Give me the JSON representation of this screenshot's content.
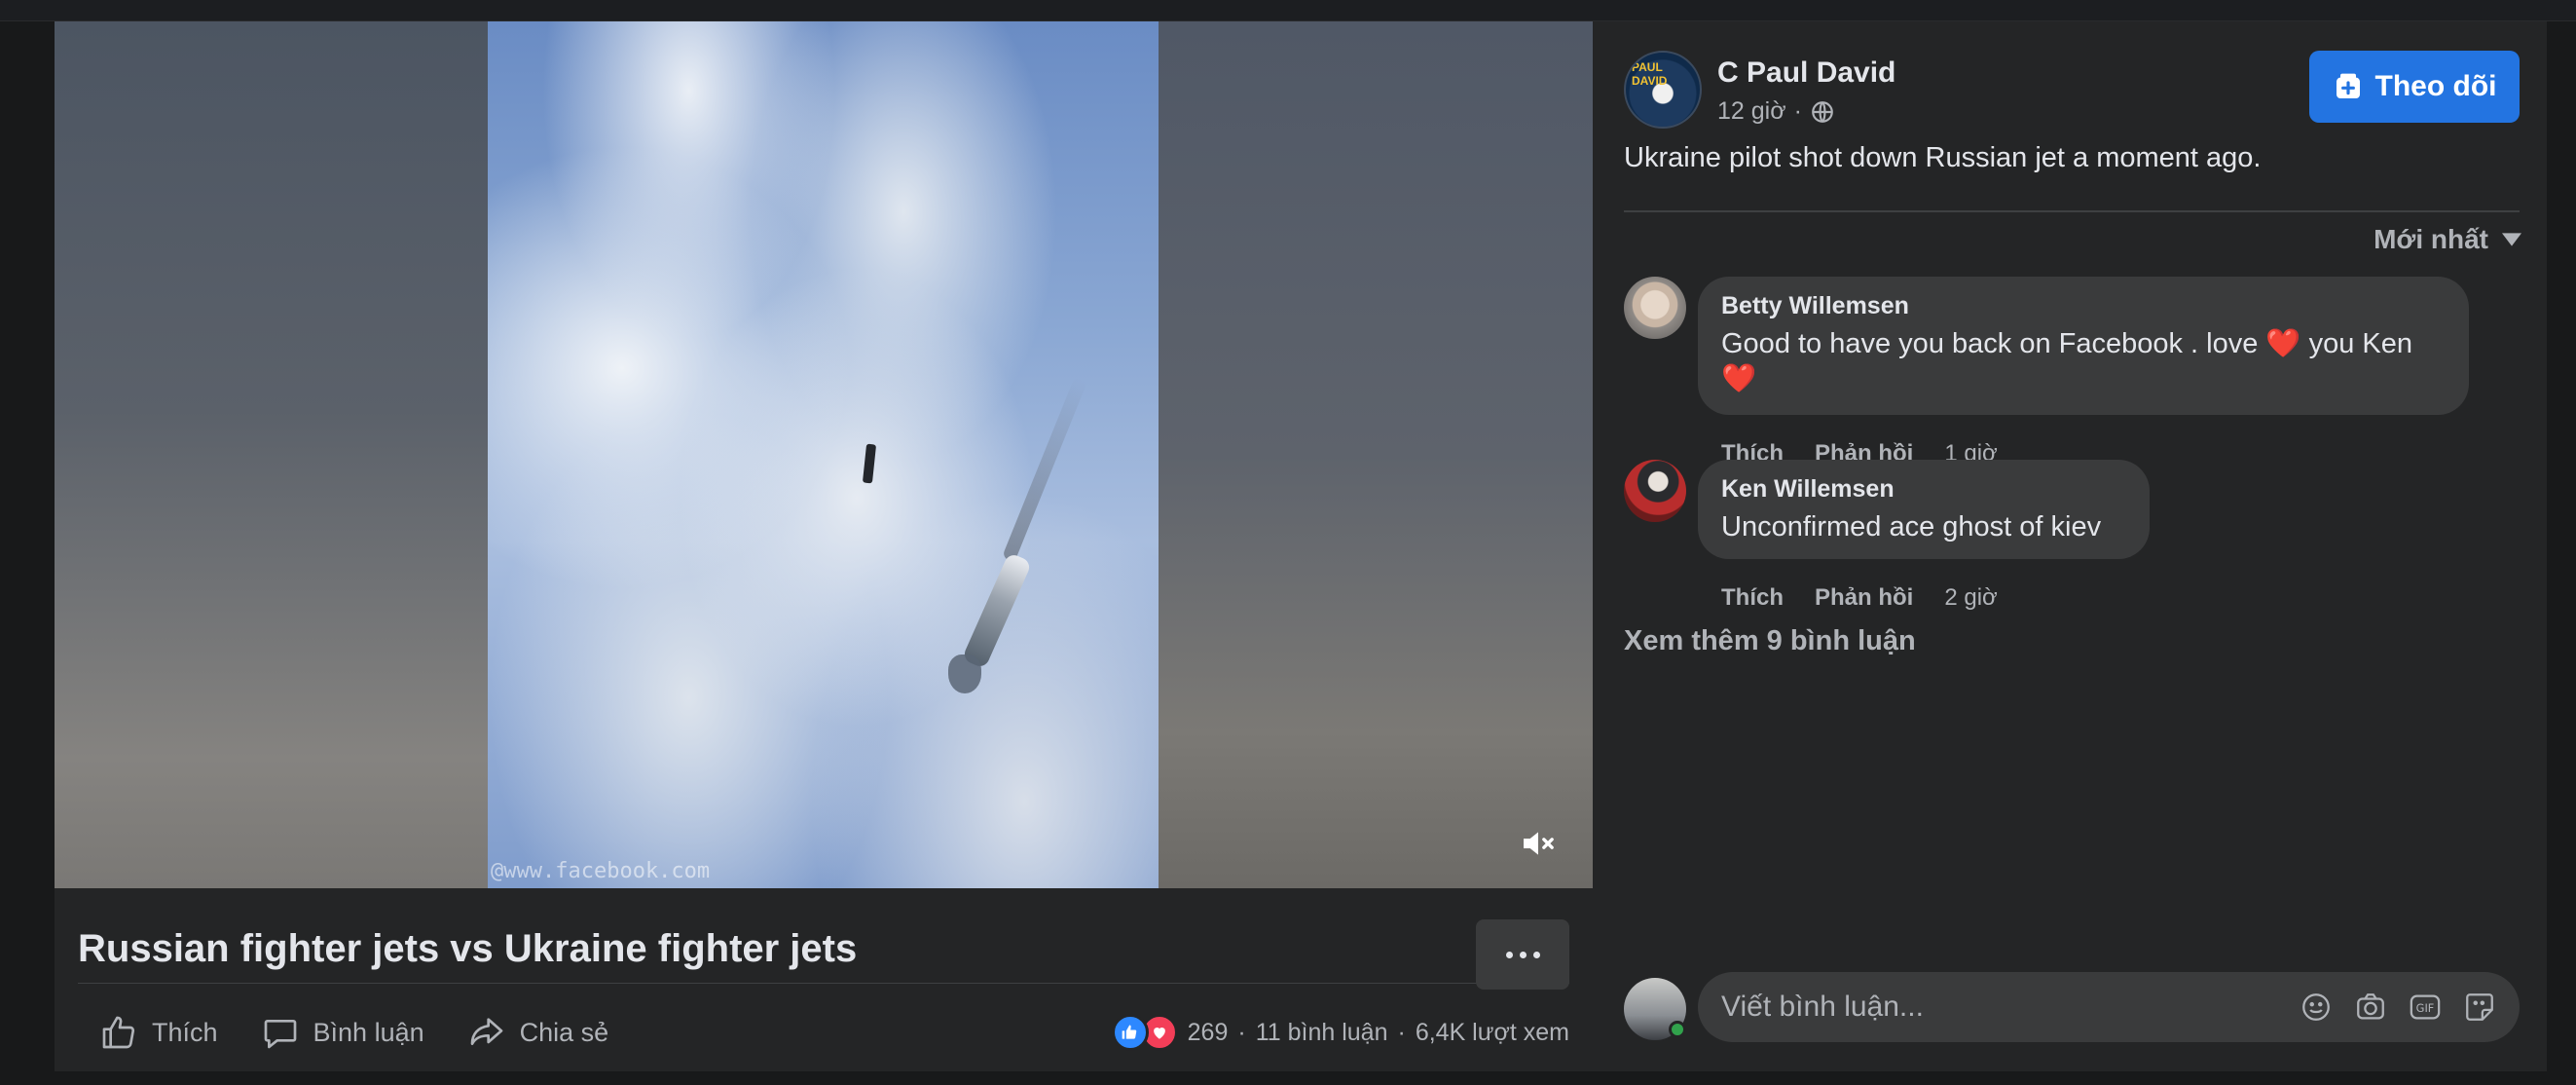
{
  "video": {
    "watermark": "@www.facebook.com",
    "title": "Russian fighter jets vs Ukraine fighter jets",
    "mute_icon": "speaker-muted-icon",
    "more_icon": "ellipsis-icon"
  },
  "actions": {
    "like_label": "Thích",
    "comment_label": "Bình luận",
    "share_label": "Chia sẻ"
  },
  "stats": {
    "reaction_count": "269",
    "sep1": "·",
    "comments": "11 bình luận",
    "sep2": "·",
    "views": "6,4K lượt xem",
    "reaction_colors": {
      "like": "#2d88ff",
      "love": "#f33e58"
    }
  },
  "post": {
    "author": "C Paul David",
    "avatar_text": "PAUL DAVID",
    "time": "12 giờ",
    "meta_sep": "·",
    "privacy_icon": "globe-icon",
    "follow_label": "Theo dõi",
    "text": "Ukraine pilot shot down Russian jet a moment ago.",
    "accent_color": "#2374e1"
  },
  "comments": {
    "sort_label": "Mới nhất",
    "items": [
      {
        "author": "Betty Willemsen",
        "text_line1": "Good to have you back on Facebook . love ❤️ you Ken",
        "text_line2": "❤️",
        "like": "Thích",
        "reply": "Phản hồi",
        "time": "1 giờ"
      },
      {
        "author": "Ken Willemsen",
        "text_line1": "Unconfirmed ace ghost of kiev",
        "like": "Thích",
        "reply": "Phản hồi",
        "time": "2 giờ"
      }
    ],
    "more_label": "Xem thêm 9 bình luận"
  },
  "composer": {
    "placeholder": "Viết bình luận...",
    "gif_label": "GIF"
  }
}
